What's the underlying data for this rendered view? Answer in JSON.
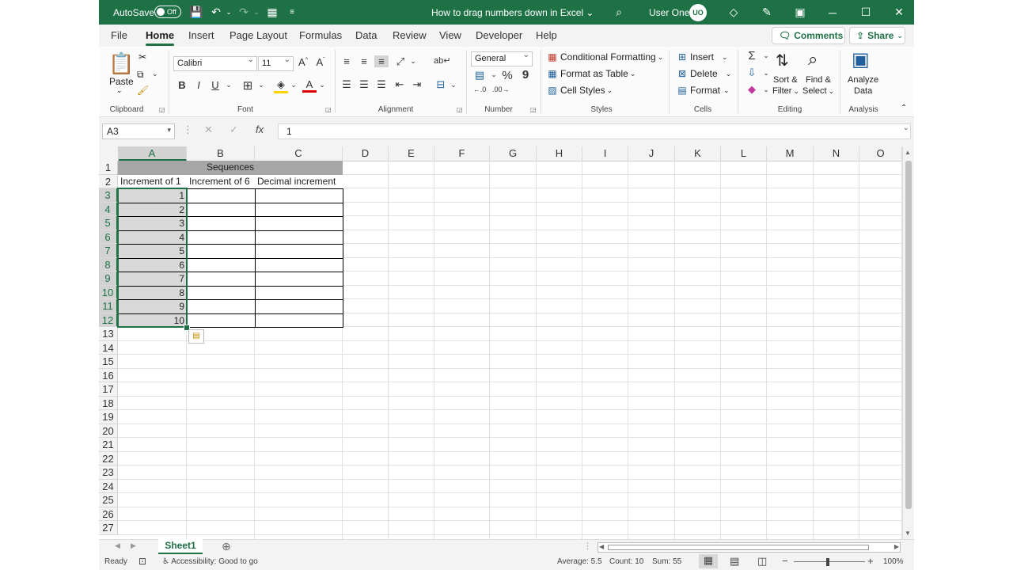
{
  "colors": {
    "brand": "#1e7145",
    "title_cell": "#a6a6a6",
    "data_cell": "#d9d9d9"
  },
  "titlebar": {
    "autosave_label": "AutoSave",
    "autosave_state": "Off",
    "doc_title": "How to drag numbers down in Excel ⌄",
    "user_name": "User One",
    "user_initials": "UO"
  },
  "tabs": [
    "File",
    "Home",
    "Insert",
    "Page Layout",
    "Formulas",
    "Data",
    "Review",
    "View",
    "Developer",
    "Help"
  ],
  "actions": {
    "comments": "Comments",
    "share": "Share"
  },
  "ribbon": {
    "clipboard": {
      "paste": "Paste",
      "label": "Clipboard"
    },
    "font": {
      "family": "Calibri",
      "size": "11",
      "label": "Font"
    },
    "alignment": {
      "label": "Alignment"
    },
    "number": {
      "format": "General",
      "label": "Number"
    },
    "styles": {
      "conditional": "Conditional Formatting",
      "format_table": "Format as Table",
      "cell_styles": "Cell Styles",
      "label": "Styles"
    },
    "cells": {
      "insert": "Insert",
      "delete": "Delete",
      "format": "Format",
      "label": "Cells"
    },
    "editing": {
      "sort": "Sort &",
      "filter": "Filter",
      "find": "Find &",
      "select": "Select",
      "label": "Editing"
    },
    "analysis": {
      "analyze": "Analyze",
      "data": "Data",
      "label": "Analysis"
    }
  },
  "formula_bar": {
    "name_box": "A3",
    "formula": "1"
  },
  "columns": [
    "A",
    "B",
    "C",
    "D",
    "E",
    "F",
    "G",
    "H",
    "I",
    "J",
    "K",
    "L",
    "M",
    "N",
    "O"
  ],
  "rows": [
    "1",
    "2",
    "3",
    "4",
    "5",
    "6",
    "7",
    "8",
    "9",
    "10",
    "11",
    "12",
    "13",
    "14",
    "15",
    "16",
    "17",
    "18",
    "19",
    "20",
    "21",
    "22",
    "23",
    "24",
    "25",
    "26",
    "27"
  ],
  "sheet": {
    "title": "Sequences",
    "headers": [
      "Increment of 1",
      "Increment of 6",
      "Decimal increment"
    ],
    "col_a": [
      "1",
      "2",
      "3",
      "4",
      "5",
      "6",
      "7",
      "8",
      "9",
      "10"
    ]
  },
  "sheet_tabs": {
    "active": "Sheet1"
  },
  "status": {
    "ready": "Ready",
    "accessibility": "Accessibility: Good to go",
    "average": "Average: 5.5",
    "count": "Count: 10",
    "sum": "Sum: 55",
    "zoom": "100%"
  }
}
